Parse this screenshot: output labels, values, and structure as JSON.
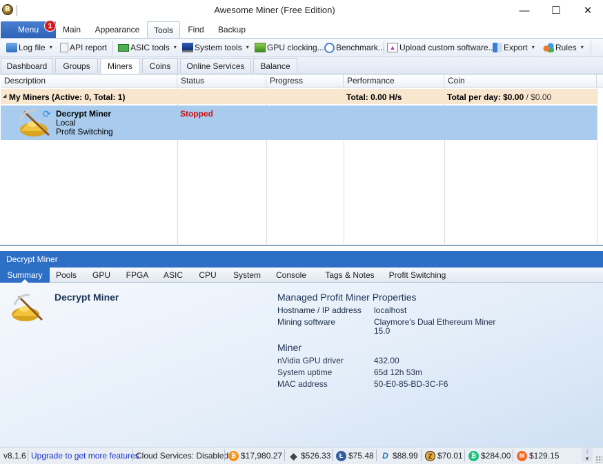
{
  "window": {
    "title": "Awesome Miner (Free Edition)",
    "minimize_glyph": "—",
    "maximize_glyph": "☐",
    "close_glyph": "✕",
    "app_icon_glyph": "B"
  },
  "ribbon": {
    "menu_label": "Menu",
    "menu_badge": "1",
    "tabs": [
      "Main",
      "Appearance",
      "Tools",
      "Find",
      "Backup"
    ],
    "active_tab": "Tools"
  },
  "toolbar": {
    "items": [
      {
        "label": "Log file",
        "icon": "folder-icon",
        "dropdown": true
      },
      {
        "label": "API report",
        "icon": "document-icon",
        "dropdown": false
      },
      {
        "label": "ASIC tools",
        "icon": "asic-board-icon",
        "dropdown": true
      },
      {
        "label": "System tools",
        "icon": "monitor-icon",
        "dropdown": true
      },
      {
        "label": "GPU clocking...",
        "icon": "gpu-chart-icon",
        "dropdown": false
      },
      {
        "label": "Benchmark...",
        "icon": "clock-gauge-icon",
        "dropdown": false
      },
      {
        "label": "Upload custom software...",
        "icon": "upload-icon",
        "dropdown": false
      },
      {
        "label": "Export",
        "icon": "export-icon",
        "dropdown": true
      },
      {
        "label": "Rules",
        "icon": "rules-icon",
        "dropdown": true
      }
    ],
    "dropdown_glyph": "▾"
  },
  "view_tabs": {
    "items": [
      "Dashboard",
      "Groups",
      "Miners",
      "Coins",
      "Online Services",
      "Balance"
    ],
    "active": "Miners"
  },
  "grid": {
    "columns": [
      "Description",
      "Status",
      "Progress",
      "Performance",
      "Coin"
    ],
    "group": {
      "expander": "◢",
      "label": "My Miners (Active: 0, Total: 1)",
      "performance": "Total: 0.00 H/s",
      "coin_prefix": "Total per day: $0.00",
      "coin_suffix": " / $0.00"
    },
    "miners": [
      {
        "name": "Decrypt Miner",
        "location": "Local",
        "mode": "Profit Switching",
        "status": "Stopped",
        "status_color": "#cc1111"
      }
    ]
  },
  "details": {
    "header": "Decrypt Miner",
    "tabs": [
      "Summary",
      "Pools",
      "GPU",
      "FPGA",
      "ASIC",
      "CPU",
      "System",
      "Console",
      "Tags & Notes",
      "Profit Switching"
    ],
    "active_tab": "Summary",
    "miner_name": "Decrypt Miner",
    "sections": [
      {
        "title": "Managed Profit Miner Properties",
        "rows": [
          {
            "label": "Hostname / IP address",
            "value": "localhost"
          },
          {
            "label": "Mining software",
            "value": "Claymore's Dual Ethereum Miner",
            "value2": "15.0"
          }
        ]
      },
      {
        "title": "Miner",
        "rows": [
          {
            "label": "nVidia GPU driver",
            "value": "432.00"
          },
          {
            "label": "System uptime",
            "value": "65d 12h 53m"
          },
          {
            "label": "MAC address",
            "value": "50-E0-85-BD-3C-F6"
          }
        ]
      }
    ]
  },
  "statusbar": {
    "version": "v8.1.6",
    "upgrade_link": "Upgrade to get more features",
    "cloud": "Cloud Services: Disabled",
    "coins": [
      {
        "name": "bitcoin",
        "glyph": "₿",
        "color": "#f7931a",
        "price": "$17,980.27"
      },
      {
        "name": "ethereum",
        "glyph": "◆",
        "color": "#444444",
        "price": "$526.33"
      },
      {
        "name": "litecoin",
        "glyph": "Ł",
        "color": "#345d9d",
        "price": "$75.48"
      },
      {
        "name": "dash",
        "glyph": "D",
        "color": "#1c75bc",
        "price": "$88.99"
      },
      {
        "name": "zcash",
        "glyph": "Z",
        "color": "#e8a93a",
        "price": "$70.01"
      },
      {
        "name": "bitcoin-cash",
        "glyph": "₿",
        "color": "#1dbf7f",
        "price": "$284.00"
      },
      {
        "name": "monero",
        "glyph": "M",
        "color": "#f26822",
        "price": "$129.15"
      }
    ]
  }
}
